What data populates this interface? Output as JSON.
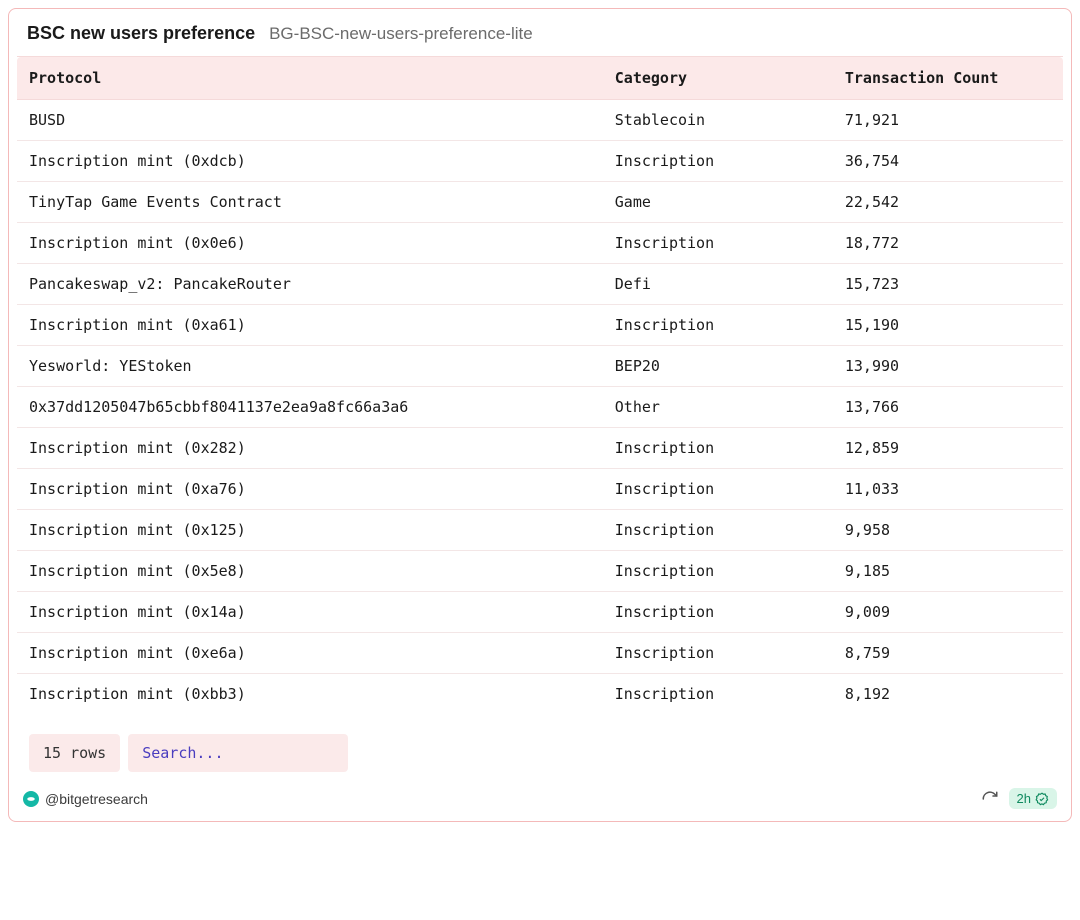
{
  "header": {
    "title": "BSC new users preference",
    "subtitle": "BG-BSC-new-users-preference-lite"
  },
  "table": {
    "columns": [
      "Protocol",
      "Category",
      "Transaction Count"
    ],
    "rows": [
      {
        "protocol": "BUSD",
        "category": "Stablecoin",
        "count": "71,921"
      },
      {
        "protocol": "Inscription mint (0xdcb)",
        "category": "Inscription",
        "count": "36,754"
      },
      {
        "protocol": "TinyTap Game Events Contract",
        "category": "Game",
        "count": "22,542"
      },
      {
        "protocol": "Inscription mint (0x0e6)",
        "category": "Inscription",
        "count": "18,772"
      },
      {
        "protocol": "Pancakeswap_v2: PancakeRouter",
        "category": "Defi",
        "count": "15,723"
      },
      {
        "protocol": "Inscription mint (0xa61)",
        "category": "Inscription",
        "count": "15,190"
      },
      {
        "protocol": "Yesworld: YEStoken",
        "category": "BEP20",
        "count": "13,990"
      },
      {
        "protocol": "0x37dd1205047b65cbbf8041137e2ea9a8fc66a3a6",
        "category": "Other",
        "count": "13,766"
      },
      {
        "protocol": "Inscription mint (0x282)",
        "category": "Inscription",
        "count": "12,859"
      },
      {
        "protocol": "Inscription mint (0xa76)",
        "category": "Inscription",
        "count": "11,033"
      },
      {
        "protocol": "Inscription mint (0x125)",
        "category": "Inscription",
        "count": "9,958"
      },
      {
        "protocol": "Inscription mint (0x5e8)",
        "category": "Inscription",
        "count": "9,185"
      },
      {
        "protocol": "Inscription mint (0x14a)",
        "category": "Inscription",
        "count": "9,009"
      },
      {
        "protocol": "Inscription mint (0xe6a)",
        "category": "Inscription",
        "count": "8,759"
      },
      {
        "protocol": "Inscription mint (0xbb3)",
        "category": "Inscription",
        "count": "8,192"
      }
    ]
  },
  "footer": {
    "row_count_label": "15 rows",
    "search_placeholder": "Search...",
    "author_handle": "@bitgetresearch",
    "age_label": "2h"
  },
  "chart_data": {
    "type": "table",
    "title": "BSC new users preference",
    "columns": [
      "Protocol",
      "Category",
      "Transaction Count"
    ],
    "rows": [
      [
        "BUSD",
        "Stablecoin",
        71921
      ],
      [
        "Inscription mint (0xdcb)",
        "Inscription",
        36754
      ],
      [
        "TinyTap Game Events Contract",
        "Game",
        22542
      ],
      [
        "Inscription mint (0x0e6)",
        "Inscription",
        18772
      ],
      [
        "Pancakeswap_v2: PancakeRouter",
        "Defi",
        15723
      ],
      [
        "Inscription mint (0xa61)",
        "Inscription",
        15190
      ],
      [
        "Yesworld: YEStoken",
        "BEP20",
        13990
      ],
      [
        "0x37dd1205047b65cbbf8041137e2ea9a8fc66a3a6",
        "Other",
        13766
      ],
      [
        "Inscription mint (0x282)",
        "Inscription",
        12859
      ],
      [
        "Inscription mint (0xa76)",
        "Inscription",
        11033
      ],
      [
        "Inscription mint (0x125)",
        "Inscription",
        9958
      ],
      [
        "Inscription mint (0x5e8)",
        "Inscription",
        9185
      ],
      [
        "Inscription mint (0x14a)",
        "Inscription",
        9009
      ],
      [
        "Inscription mint (0xe6a)",
        "Inscription",
        8759
      ],
      [
        "Inscription mint (0xbb3)",
        "Inscription",
        8192
      ]
    ]
  }
}
